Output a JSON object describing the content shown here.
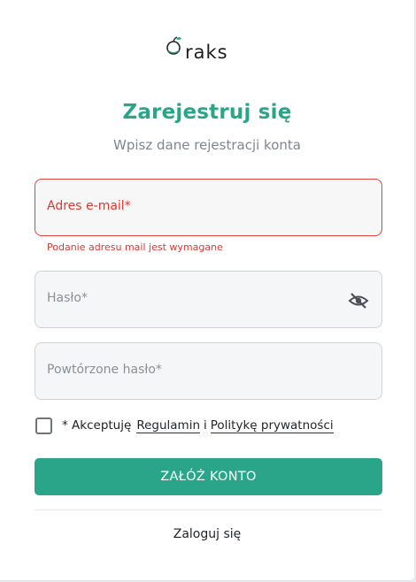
{
  "logo": {
    "wordmark": "raks"
  },
  "header": {
    "title": "Zarejestruj się",
    "subtitle": "Wpisz dane rejestracji konta"
  },
  "form": {
    "email": {
      "placeholder": "Adres e-mail*",
      "value": "",
      "error": "Podanie adresu mail jest wymagane"
    },
    "password": {
      "placeholder": "Hasło*",
      "value": "",
      "toggle_icon": "eye-off-icon"
    },
    "password_repeat": {
      "placeholder": "Powtórzone hasło*",
      "value": ""
    },
    "terms": {
      "checked": false,
      "prefix": "* Akceptuję",
      "link_regulations": "Regulamin",
      "separator": "i",
      "link_privacy": "Politykę prywatności"
    },
    "submit_label": "ZAŁÓŻ KONTO",
    "login_link": "Zaloguj się"
  },
  "colors": {
    "accent": "#2ba58a",
    "error": "#d83a33"
  }
}
